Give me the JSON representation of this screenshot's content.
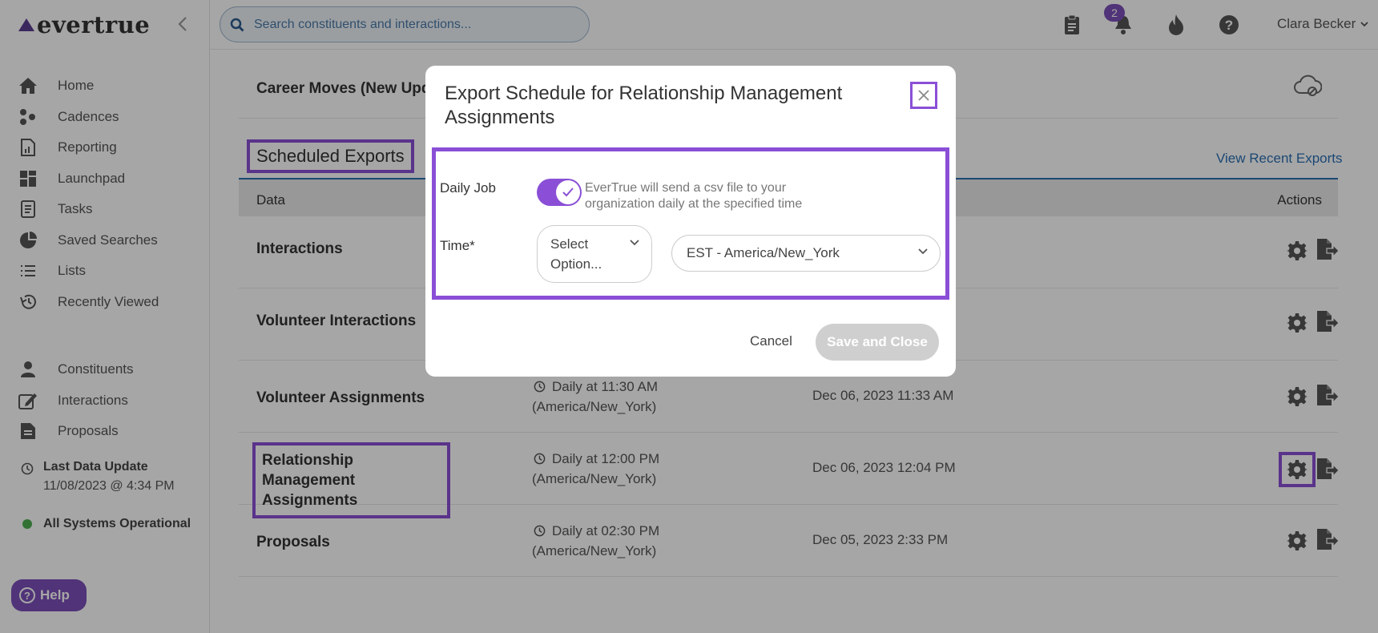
{
  "app": {
    "logo": "evertrue"
  },
  "search": {
    "placeholder": "Search constituents and interactions..."
  },
  "header": {
    "notification_count": "2",
    "user_name": "Clara Becker"
  },
  "sidebar": {
    "items": [
      {
        "label": "Home",
        "icon": "home-icon"
      },
      {
        "label": "Cadences",
        "icon": "cadences-icon"
      },
      {
        "label": "Reporting",
        "icon": "reporting-icon"
      },
      {
        "label": "Launchpad",
        "icon": "launchpad-icon"
      },
      {
        "label": "Tasks",
        "icon": "tasks-icon"
      },
      {
        "label": "Saved Searches",
        "icon": "saved-searches-icon"
      },
      {
        "label": "Lists",
        "icon": "lists-icon"
      },
      {
        "label": "Recently Viewed",
        "icon": "history-icon"
      }
    ],
    "items2": [
      {
        "label": "Constituents",
        "icon": "person-icon"
      },
      {
        "label": "Interactions",
        "icon": "edit-icon"
      },
      {
        "label": "Proposals",
        "icon": "document-icon"
      }
    ],
    "last_update_label": "Last Data Update",
    "last_update_value": "11/08/2023 @ 4:34 PM",
    "status": "All Systems Operational",
    "help": "Help"
  },
  "main": {
    "career_row": "Career Moves (New Upda",
    "section_title": "Scheduled Exports",
    "view_recent": "View Recent Exports",
    "columns": {
      "data": "Data",
      "actions": "Actions"
    },
    "rows": [
      {
        "name": "Interactions",
        "schedule": "",
        "tz": "",
        "date": ""
      },
      {
        "name": "Volunteer Interactions",
        "schedule": "",
        "tz": "",
        "date": ""
      },
      {
        "name": "Volunteer Assignments",
        "schedule": "Daily at 11:30 AM",
        "tz": "(America/New_York)",
        "date": "Dec 06, 2023 11:33 AM"
      },
      {
        "name": "Relationship Management Assignments",
        "schedule": "Daily at 12:00 PM",
        "tz": "(America/New_York)",
        "date": "Dec 06, 2023 12:04 PM"
      },
      {
        "name": "Proposals",
        "schedule": "Daily at 02:30 PM",
        "tz": "(America/New_York)",
        "date": "Dec 05, 2023 2:33 PM"
      }
    ]
  },
  "modal": {
    "title": "Export Schedule for Relationship Management Assignments",
    "daily_label": "Daily Job",
    "daily_enabled": true,
    "daily_desc": "EverTrue will send a csv file to your organization daily at the specified time",
    "time_label": "Time*",
    "time_select": "Select Option...",
    "timezone_select": "EST - America/New_York",
    "cancel": "Cancel",
    "save": "Save and Close"
  },
  "colors": {
    "accent": "#8a4fd6",
    "brand": "#7b4fb8",
    "link": "#2a6fb3",
    "status_ok": "#4caf50"
  }
}
